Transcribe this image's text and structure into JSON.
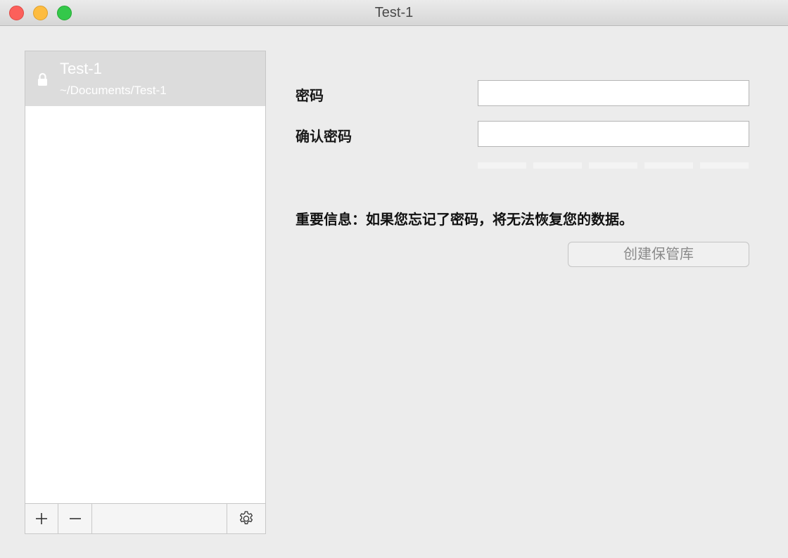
{
  "window": {
    "title": "Test-1"
  },
  "traffic_lights": {
    "close_color": "#fc605b",
    "minimize_color": "#fdbc40",
    "maximize_color": "#34c84a"
  },
  "vault_list": {
    "items": [
      {
        "name": "Test-1",
        "path": "~/Documents/Test-1",
        "icon": "lock-icon",
        "selected": true
      }
    ],
    "toolbar": {
      "add_label": "+",
      "remove_label": "−",
      "settings_icon": "gear-icon"
    }
  },
  "form": {
    "password_label": "密码",
    "password_value": "",
    "confirm_label": "确认密码",
    "confirm_value": "",
    "strength_segments": 5,
    "strength_filled": 0,
    "warning": "重要信息：如果您忘记了密码，将无法恢复您的数据。",
    "create_button": "创建保管库"
  }
}
